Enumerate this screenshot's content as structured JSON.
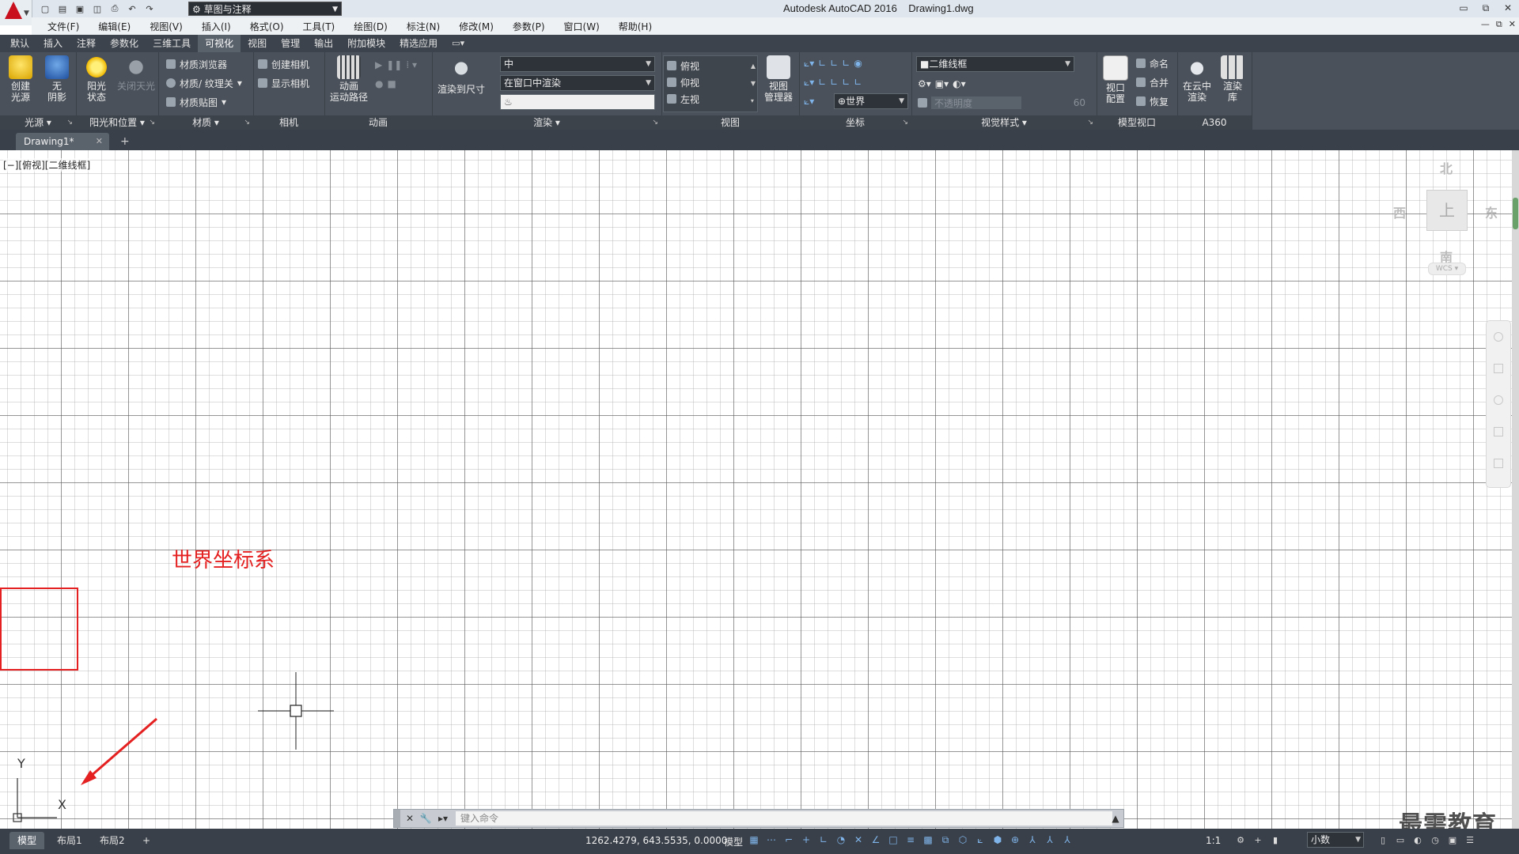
{
  "titlebar": {
    "workspace": "草图与注释",
    "app_title": "Autodesk AutoCAD 2016",
    "doc_title": "Drawing1.dwg",
    "controls": [
      "▭",
      "⧉",
      "✕"
    ]
  },
  "qat_icons": [
    "new-file-icon",
    "open-icon",
    "save-icon",
    "save-as-icon",
    "print-icon",
    "undo-icon",
    "redo-icon"
  ],
  "menubar": {
    "items": [
      "文件(F)",
      "编辑(E)",
      "视图(V)",
      "插入(I)",
      "格式(O)",
      "工具(T)",
      "绘图(D)",
      "标注(N)",
      "修改(M)",
      "参数(P)",
      "窗口(W)",
      "帮助(H)"
    ]
  },
  "ribbon_tabs": {
    "items": [
      "默认",
      "插入",
      "注释",
      "参数化",
      "三维工具",
      "可视化",
      "视图",
      "管理",
      "输出",
      "附加模块",
      "精选应用"
    ],
    "active_index": 5
  },
  "panels": {
    "lights": {
      "label": "光源",
      "create_light": [
        "创建",
        "光源"
      ],
      "no_shadow": [
        "无",
        "阴影"
      ]
    },
    "sun": {
      "label": "阳光和位置",
      "sun_state": [
        "阳光",
        "状态"
      ],
      "sky_off": "关闭天光"
    },
    "materials": {
      "label": "材质",
      "browser": "材质浏览器",
      "texture": "材质/ 纹理关",
      "mapping": "材质贴图"
    },
    "camera": {
      "label": "相机",
      "create": "创建相机",
      "show": "显示相机"
    },
    "animation": {
      "label": "动画",
      "path": [
        "动画",
        "运动路径"
      ]
    },
    "render": {
      "label": "渲染",
      "size_btn": "渲染到尺寸",
      "quality": "中",
      "mode": "在窗口中渲染"
    },
    "views": {
      "label": "视图",
      "items": [
        "俯视",
        "仰视",
        "左视"
      ],
      "manager": [
        "视图",
        "管理器"
      ]
    },
    "coords": {
      "label": "坐标",
      "ucs": "世界"
    },
    "visual_styles": {
      "label": "视觉样式",
      "style": "二维线框",
      "opacity_label": "不透明度",
      "opacity_value": "60"
    },
    "model_viewports": {
      "label": "模型视口",
      "config": [
        "视口",
        "配置"
      ],
      "name": "命名",
      "join": "合并",
      "restore": "恢复"
    },
    "a360": {
      "label": "A360",
      "cloud": [
        "在云中",
        "渲染"
      ],
      "gallery": [
        "渲染",
        "库"
      ]
    }
  },
  "doctabs": {
    "active": "Drawing1*",
    "close": "✕",
    "add": "+"
  },
  "viewport": {
    "label": "[−][俯视][二维线框]"
  },
  "viewcube": {
    "north": "北",
    "south": "南",
    "east": "东",
    "west": "西",
    "face": "上",
    "wcs": "WCS ▾"
  },
  "annotation": {
    "text": "世界坐标系",
    "color": "#e52020"
  },
  "ucs_icon": {
    "x": "X",
    "y": "Y"
  },
  "command": {
    "placeholder": "键入命令"
  },
  "statusbar": {
    "layouts": [
      "模型",
      "布局1",
      "布局2"
    ],
    "add_layout": "+",
    "coordinates": "1262.4279, 643.5535, 0.0000",
    "model": "模型",
    "scale": "1:1",
    "units": "小数"
  },
  "watermark": "最需教育",
  "colors": {
    "accent": "#7fb4ea",
    "ribbon_bg": "#4a515a",
    "annotation": "#e52020"
  }
}
